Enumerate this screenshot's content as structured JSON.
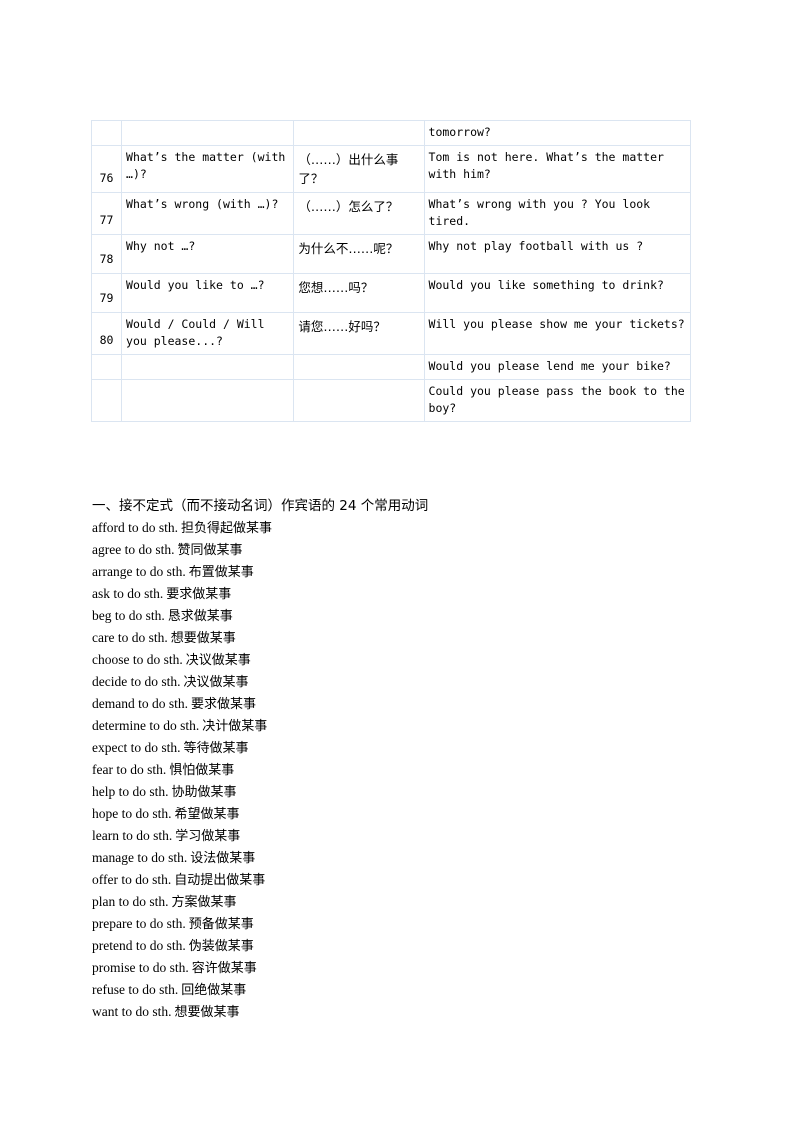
{
  "document": {
    "page_background": "#ffffff",
    "table_border_color": "#dbe5f1"
  },
  "table": {
    "name": "common-sentence-patterns-table",
    "rows": [
      {
        "num": "",
        "english": "",
        "chinese": "",
        "example": "tomorrow?"
      },
      {
        "num": "76",
        "english": "What’s the matter (with …)?",
        "chinese": "（……）出什么事了？",
        "example": "Tom is not here. What’s the matter with him?"
      },
      {
        "num": "77",
        "english": "What’s wrong (with …)?",
        "chinese": "（……）怎么了？",
        "example": "What’s wrong with you ? You look tired."
      },
      {
        "num": "78",
        "english": "Why not …?",
        "chinese": "为什么不……呢？",
        "example": "Why not play football with us ?"
      },
      {
        "num": "79",
        "english": "Would you like to …?",
        "chinese": "您想……吗？",
        "example": "Would you like something to drink?"
      },
      {
        "num": "80",
        "english": "Would / Could / Will you please...?",
        "chinese": "请您……好吗？",
        "example": "Will you please show me your tickets?"
      },
      {
        "num": "",
        "english": "",
        "chinese": "",
        "example": "Would you please lend me your bike?"
      },
      {
        "num": "",
        "english": "",
        "chinese": "",
        "example": "Could you please pass the book to the boy?"
      }
    ]
  },
  "verb_section": {
    "heading": "一、接不定式（而不接动名词）作宾语的 24 个常用动词",
    "items": [
      {
        "en": "afford to do sth.",
        "cn": "担负得起做某事"
      },
      {
        "en": "agree to do sth.",
        "cn": "赞同做某事"
      },
      {
        "en": "arrange to do sth.",
        "cn": "布置做某事"
      },
      {
        "en": "ask to do sth.",
        "cn": "要求做某事"
      },
      {
        "en": "beg to do sth.",
        "cn": "恳求做某事"
      },
      {
        "en": "care to do sth.",
        "cn": "想要做某事"
      },
      {
        "en": "choose to do sth.",
        "cn": "决议做某事"
      },
      {
        "en": "decide to do sth.",
        "cn": "决议做某事"
      },
      {
        "en": "demand to do sth.",
        "cn": "要求做某事"
      },
      {
        "en": "determine to do sth.",
        "cn": "决计做某事"
      },
      {
        "en": "expect to do sth.",
        "cn": "等待做某事"
      },
      {
        "en": "fear to do sth.",
        "cn": "惧怕做某事"
      },
      {
        "en": "help to do sth.",
        "cn": "协助做某事"
      },
      {
        "en": "hope to do sth.",
        "cn": "希望做某事"
      },
      {
        "en": "learn to do sth.",
        "cn": "学习做某事"
      },
      {
        "en": "manage to do sth.",
        "cn": "设法做某事"
      },
      {
        "en": "offer to do sth.",
        "cn": "自动提出做某事"
      },
      {
        "en": "plan to do sth.",
        "cn": "方案做某事"
      },
      {
        "en": "prepare to do sth.",
        "cn": "预备做某事"
      },
      {
        "en": "pretend to do sth.",
        "cn": "伪装做某事"
      },
      {
        "en": "promise to do sth.",
        "cn": "容许做某事"
      },
      {
        "en": "refuse to do sth.",
        "cn": "回绝做某事"
      },
      {
        "en": "want to do sth.",
        "cn": "想要做某事"
      }
    ]
  }
}
